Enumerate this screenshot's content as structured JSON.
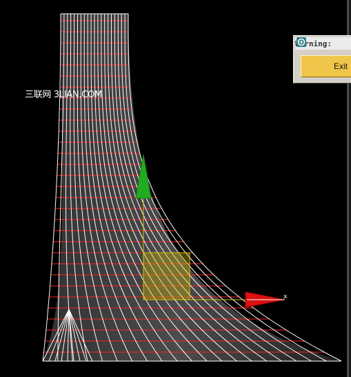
{
  "viewport": {
    "watermark": "三联网 3LIAN.COM",
    "axis_x_label": "x",
    "colors": {
      "background": "#000000",
      "mesh_white": "#ffffff",
      "mesh_red": "#ff2020",
      "surface_gray": "#6e6e6e",
      "gizmo_x": "#dd1111",
      "gizmo_y": "#22aa22",
      "gizmo_plane": "#c8b400"
    }
  },
  "dialog": {
    "title": "Warning:",
    "icon": "app-swirl-icon",
    "exit_label": "Exit"
  }
}
